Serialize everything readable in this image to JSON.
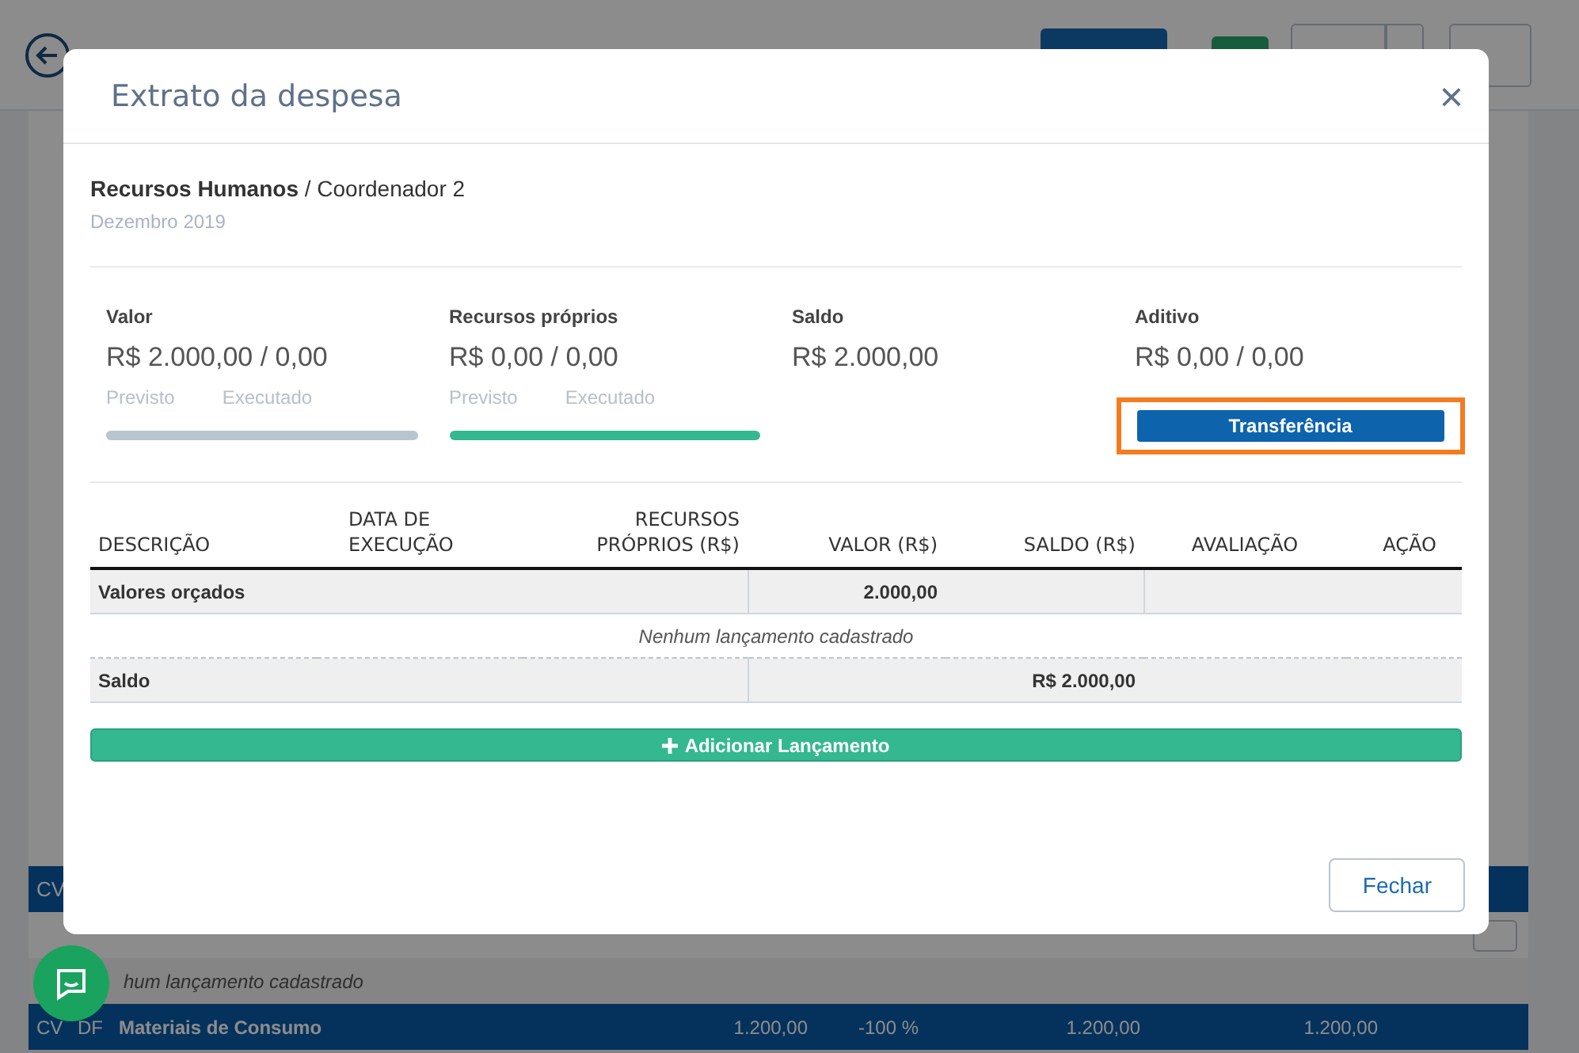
{
  "background": {
    "section_code": "CV",
    "empty": "hum lançamento cadastrado",
    "group": {
      "codes": [
        "CV",
        "DF"
      ],
      "label": "Materiais de Consumo",
      "cells": [
        "1.200,00",
        "-100 %",
        "1.200,00",
        "1.200,00"
      ]
    }
  },
  "modal": {
    "title": "Extrato da despesa",
    "close": "×",
    "breadcrumb": "**Recursos Humanos** / Coordenador 2",
    "date": "Dezembro 2019",
    "stats": [
      {
        "label": "Valor",
        "amount": "R$ 2.000,00 / 0,00",
        "sublabels": [
          "Previsto",
          "Executado"
        ],
        "bar": {
          "color": "#b9c4d1"
        }
      },
      {
        "label": "Recursos próprios",
        "amount": "R$ 0,00 / 0,00",
        "sublabels": [
          "Previsto",
          "Executado"
        ],
        "bar": {
          "color": "#34b88f"
        }
      },
      {
        "label": "Saldo",
        "amount": "R$ 2.000,00"
      },
      {
        "label": "Aditivo",
        "amount": "R$ 0,00 / 0,00",
        "action": {
          "label": "Transferência",
          "highlighted": true
        }
      }
    ],
    "table": {
      "columns": [
        [
          "DESCRIÇÃO"
        ],
        [
          "DATA DE",
          "EXECUÇÃO"
        ],
        [
          "RECURSOS",
          "PRÓPRIOS (R$)"
        ],
        [
          "VALOR (R$)"
        ],
        [
          "SALDO (R$)"
        ],
        [
          "AVALIAÇÃO"
        ],
        [
          "AÇÃO"
        ]
      ],
      "budget_row": {
        "label": "Valores orçados",
        "value": "2.000,00"
      },
      "empty": "Nenhum lançamento cadastrado",
      "balance_row": {
        "label": "Saldo",
        "value": "R$ 2.000,00"
      }
    },
    "add_button": "Adicionar Lançamento",
    "close_button": "Fechar"
  }
}
